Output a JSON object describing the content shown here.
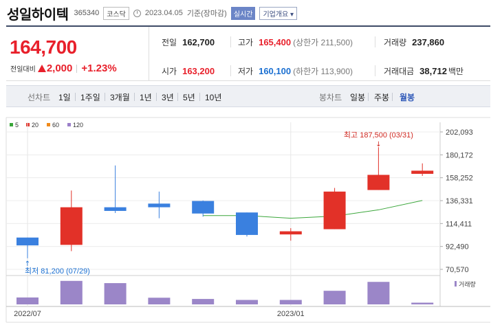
{
  "header": {
    "name": "성일하이텍",
    "code": "365340",
    "market": "코스닥",
    "date": "2023.04.05",
    "basis": "기준(장마감)",
    "live_button": "실시간",
    "corp_button": "기업개요 ▾"
  },
  "price": {
    "current": "164,700",
    "change_label": "전일대비",
    "change": "2,000",
    "change_pct": "+1.23%"
  },
  "stats": {
    "prev_close_label": "전일",
    "prev_close": "162,700",
    "high_label": "고가",
    "high": "165,400",
    "upper_limit": "(상한가 211,500)",
    "volume_label": "거래량",
    "volume": "237,860",
    "open_label": "시가",
    "open": "163,200",
    "low_label": "저가",
    "low": "160,100",
    "lower_limit": "(하한가 113,900)",
    "amount_label": "거래대금",
    "amount": "38,712",
    "amount_unit": "백만"
  },
  "periods": {
    "line_label": "선차트",
    "line_items": [
      "1일",
      "1주일",
      "3개월",
      "1년",
      "3년",
      "5년",
      "10년"
    ],
    "candle_label": "봉차트",
    "candle_items": [
      "일봉",
      "주봉",
      "월봉"
    ],
    "active": "월봉"
  },
  "colors": {
    "up": "#e23128",
    "down": "#3a80df",
    "ma5": "#3aa63a",
    "ma20": "#e23128",
    "ma60": "#f08a1a",
    "ma120": "#9b7fc9",
    "volume": "#9b86c8"
  },
  "chart_data": {
    "type": "candlestick",
    "legend": [
      "5",
      "20",
      "60",
      "120"
    ],
    "y_ticks": [
      202093,
      180172,
      158252,
      136331,
      114411,
      92490,
      70570
    ],
    "ylim": [
      70570,
      202093
    ],
    "x_labels": [
      "2022/07",
      "2023/01"
    ],
    "candles": [
      {
        "month": "2022/07",
        "open": 101000,
        "high": 101000,
        "low": 81200,
        "close": 93500
      },
      {
        "month": "2022/08",
        "open": 94000,
        "high": 146000,
        "low": 88000,
        "close": 130000
      },
      {
        "month": "2022/09",
        "open": 130000,
        "high": 170000,
        "low": 124500,
        "close": 126500
      },
      {
        "month": "2022/10",
        "open": 133500,
        "high": 145000,
        "low": 119500,
        "close": 130000
      },
      {
        "month": "2022/11",
        "open": 136000,
        "high": 136500,
        "low": 121000,
        "close": 124000
      },
      {
        "month": "2022/12",
        "open": 125000,
        "high": 125000,
        "low": 102000,
        "close": 103500
      },
      {
        "month": "2023/01",
        "open": 104000,
        "high": 110000,
        "low": 98000,
        "close": 107000
      },
      {
        "month": "2023/02",
        "open": 109000,
        "high": 148500,
        "low": 109000,
        "close": 145000
      },
      {
        "month": "2023/03",
        "open": 146500,
        "high": 187500,
        "low": 146500,
        "close": 161000
      },
      {
        "month": "2023/04",
        "open": 162000,
        "high": 172000,
        "low": 160000,
        "close": 165000
      }
    ],
    "ma5_line": [
      {
        "month": "2022/11",
        "value": 122000
      },
      {
        "month": "2022/12",
        "value": 122000
      },
      {
        "month": "2023/01",
        "value": 119500
      },
      {
        "month": "2023/02",
        "value": 121500
      },
      {
        "month": "2023/03",
        "value": 127500
      },
      {
        "month": "2023/04",
        "value": 136500
      }
    ],
    "volume": [
      0.28,
      0.95,
      0.86,
      0.27,
      0.22,
      0.18,
      0.18,
      0.55,
      0.91,
      0.07
    ],
    "volume_label": "거래량",
    "annotations": {
      "high_label": "최고 187,500 (03/31)",
      "low_label": "최저 81,200 (07/29)"
    }
  }
}
